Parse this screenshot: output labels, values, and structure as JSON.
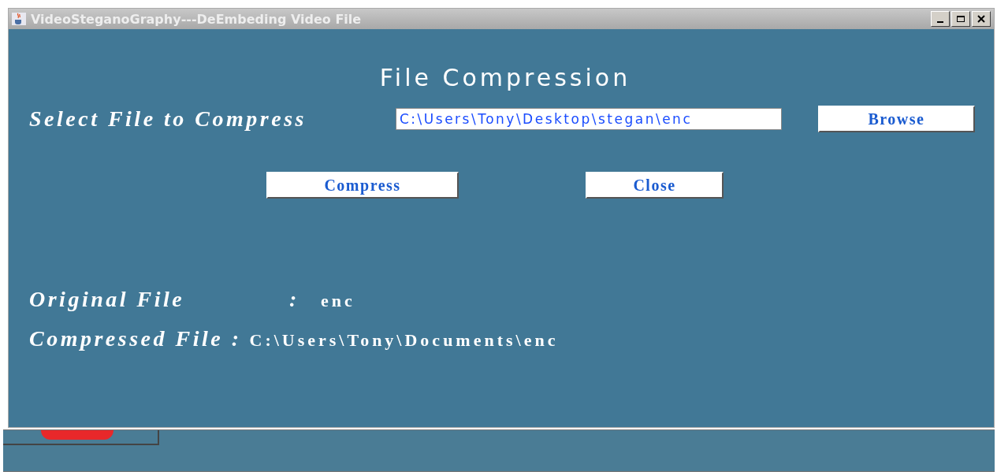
{
  "window": {
    "title": "VideoSteganoGraphy---DeEmbeding Video File"
  },
  "heading": "File Compression",
  "select": {
    "label": "Select File to Compress",
    "value": "C:\\Users\\Tony\\Desktop\\stegan\\enc",
    "button": "Browse"
  },
  "actions": [
    "Compress",
    "Close"
  ],
  "info": [
    {
      "label": "Original File",
      "separator": ":",
      "value": "enc"
    },
    {
      "label": "Compressed File :",
      "value": "C:\\Users\\Tony\\Documents\\enc"
    }
  ]
}
